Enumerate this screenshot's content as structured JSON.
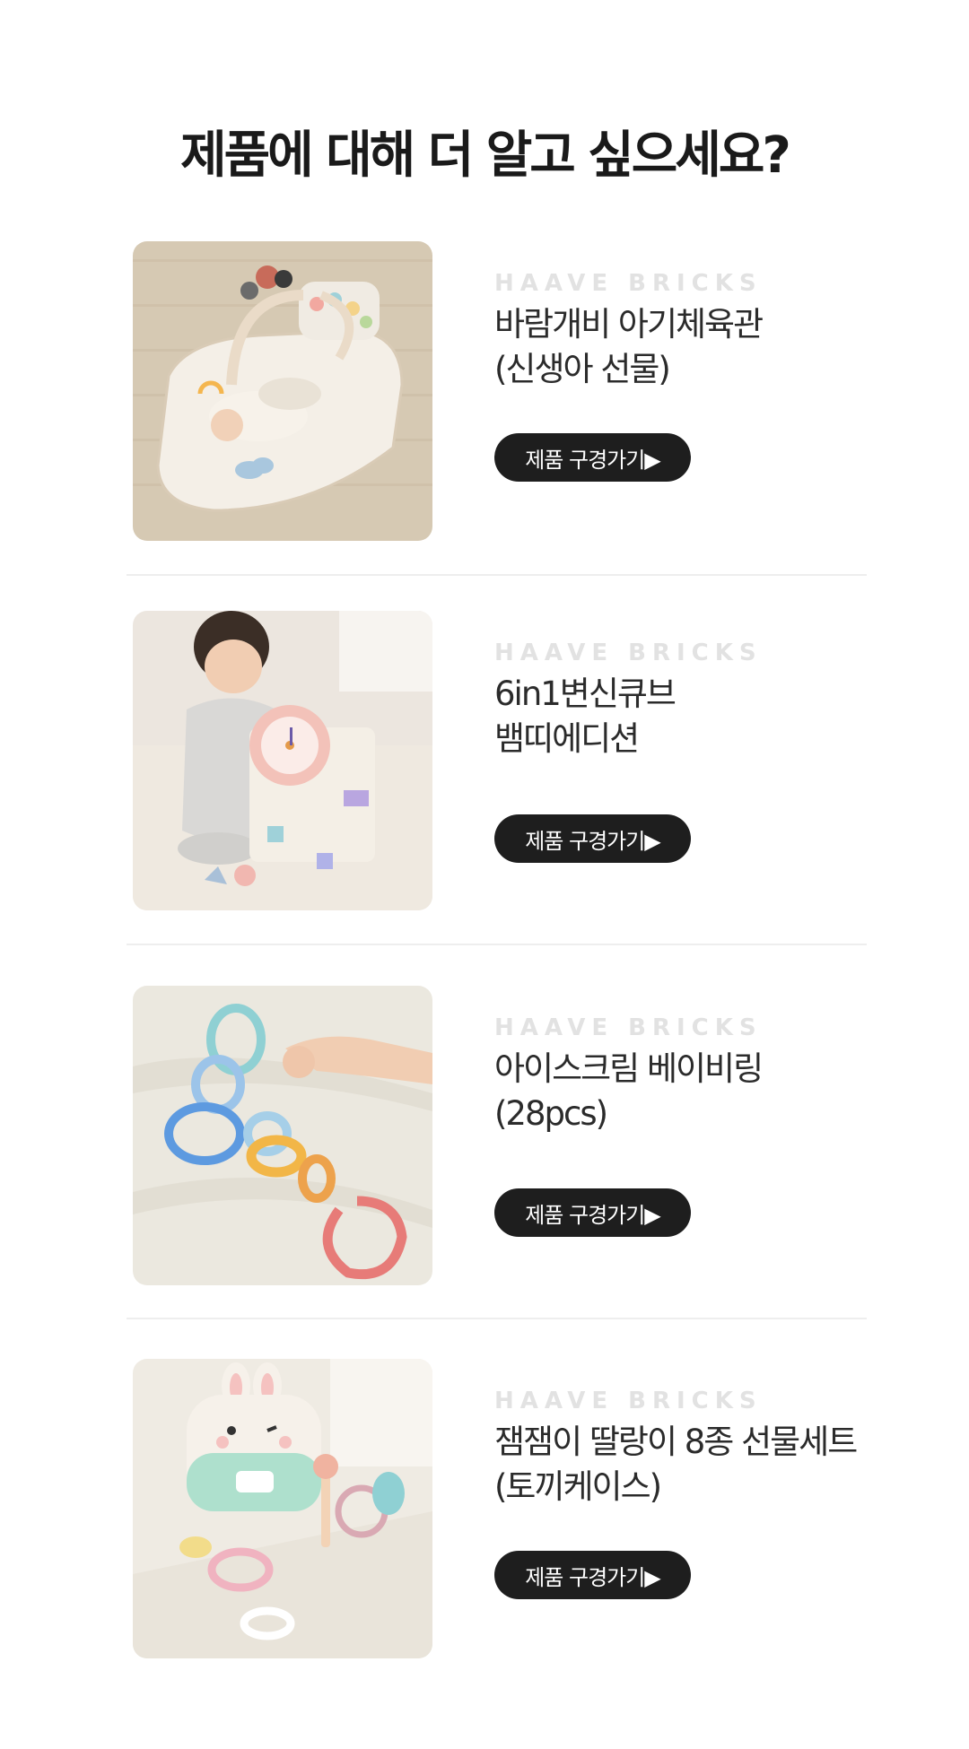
{
  "page": {
    "title": "제품에 대해 더 알고 싶으세요?"
  },
  "products": [
    {
      "brand": "HAAVE BRICKS",
      "name_line1": "바람개비 아기체육관",
      "name_line2": "(신생아 선물)",
      "button_label": "제품 구경가기▶"
    },
    {
      "brand": "HAAVE BRICKS",
      "name_line1": "6in1변신큐브",
      "name_line2": "뱀띠에디션",
      "button_label": "제품 구경가기▶"
    },
    {
      "brand": "HAAVE BRICKS",
      "name_line1": "아이스크림 베이비링",
      "name_line2": "(28pcs)",
      "button_label": "제품 구경가기▶"
    },
    {
      "brand": "HAAVE BRICKS",
      "name_line1": "잼잼이 딸랑이 8종 선물세트",
      "name_line2": "(토끼케이스)",
      "button_label": "제품 구경가기▶"
    }
  ],
  "colors": {
    "background": "#ffffff",
    "title": "#1a1a1a",
    "brand": "#e2e2e2",
    "button": "#1e1e1e",
    "divider": "#eeeeee"
  }
}
